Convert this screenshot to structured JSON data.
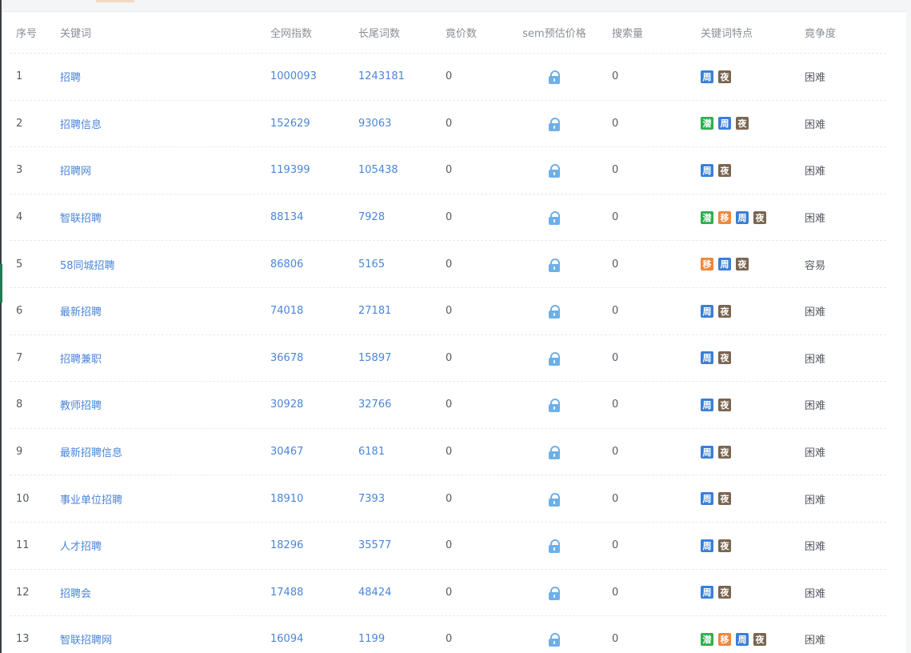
{
  "colors": {
    "link": "#4a86d8",
    "header_text": "#8a8f96",
    "body_text": "#555b62",
    "lock": "#6db0e8",
    "tag_qian": "#2fae4f",
    "tag_yi": "#f0873a",
    "tag_zhou": "#3b7fd6",
    "tag_ye": "#7a6551"
  },
  "table": {
    "headers": {
      "index": "序号",
      "keyword": "关键词",
      "all_index": "全网指数",
      "long_tail": "长尾词数",
      "bid_count": "竟价数",
      "sem_price": "sem预估价格",
      "search_volume": "搜索量",
      "features": "关键词特点",
      "difficulty": "竟争度"
    },
    "tag_labels": {
      "qian": "潜",
      "yi": "移",
      "zhou": "周",
      "ye": "夜"
    },
    "sem_icon": "lock-icon",
    "rows": [
      {
        "index": "1",
        "keyword": "招聘",
        "all_index": "1000093",
        "long_tail": "1243181",
        "bid": "0",
        "volume": "0",
        "tags": [
          "zhou",
          "ye"
        ],
        "difficulty": "困难"
      },
      {
        "index": "2",
        "keyword": "招聘信息",
        "all_index": "152629",
        "long_tail": "93063",
        "bid": "0",
        "volume": "0",
        "tags": [
          "qian",
          "zhou",
          "ye"
        ],
        "difficulty": "困难"
      },
      {
        "index": "3",
        "keyword": "招聘网",
        "all_index": "119399",
        "long_tail": "105438",
        "bid": "0",
        "volume": "0",
        "tags": [
          "zhou",
          "ye"
        ],
        "difficulty": "困难"
      },
      {
        "index": "4",
        "keyword": "智联招聘",
        "all_index": "88134",
        "long_tail": "7928",
        "bid": "0",
        "volume": "0",
        "tags": [
          "qian",
          "yi",
          "zhou",
          "ye"
        ],
        "difficulty": "困难"
      },
      {
        "index": "5",
        "keyword": "58同城招聘",
        "all_index": "86806",
        "long_tail": "5165",
        "bid": "0",
        "volume": "0",
        "tags": [
          "yi",
          "zhou",
          "ye"
        ],
        "difficulty": "容易"
      },
      {
        "index": "6",
        "keyword": "最新招聘",
        "all_index": "74018",
        "long_tail": "27181",
        "bid": "0",
        "volume": "0",
        "tags": [
          "zhou",
          "ye"
        ],
        "difficulty": "困难"
      },
      {
        "index": "7",
        "keyword": "招聘兼职",
        "all_index": "36678",
        "long_tail": "15897",
        "bid": "0",
        "volume": "0",
        "tags": [
          "zhou",
          "ye"
        ],
        "difficulty": "困难"
      },
      {
        "index": "8",
        "keyword": "教师招聘",
        "all_index": "30928",
        "long_tail": "32766",
        "bid": "0",
        "volume": "0",
        "tags": [
          "zhou",
          "ye"
        ],
        "difficulty": "困难"
      },
      {
        "index": "9",
        "keyword": "最新招聘信息",
        "all_index": "30467",
        "long_tail": "6181",
        "bid": "0",
        "volume": "0",
        "tags": [
          "zhou",
          "ye"
        ],
        "difficulty": "困难"
      },
      {
        "index": "10",
        "keyword": "事业单位招聘",
        "all_index": "18910",
        "long_tail": "7393",
        "bid": "0",
        "volume": "0",
        "tags": [
          "zhou",
          "ye"
        ],
        "difficulty": "困难"
      },
      {
        "index": "11",
        "keyword": "人才招聘",
        "all_index": "18296",
        "long_tail": "35577",
        "bid": "0",
        "volume": "0",
        "tags": [
          "zhou",
          "ye"
        ],
        "difficulty": "困难"
      },
      {
        "index": "12",
        "keyword": "招聘会",
        "all_index": "17488",
        "long_tail": "48424",
        "bid": "0",
        "volume": "0",
        "tags": [
          "zhou",
          "ye"
        ],
        "difficulty": "困难"
      },
      {
        "index": "13",
        "keyword": "智联招聘网",
        "all_index": "16094",
        "long_tail": "1199",
        "bid": "0",
        "volume": "0",
        "tags": [
          "qian",
          "yi",
          "zhou",
          "ye"
        ],
        "difficulty": "困难"
      }
    ]
  }
}
